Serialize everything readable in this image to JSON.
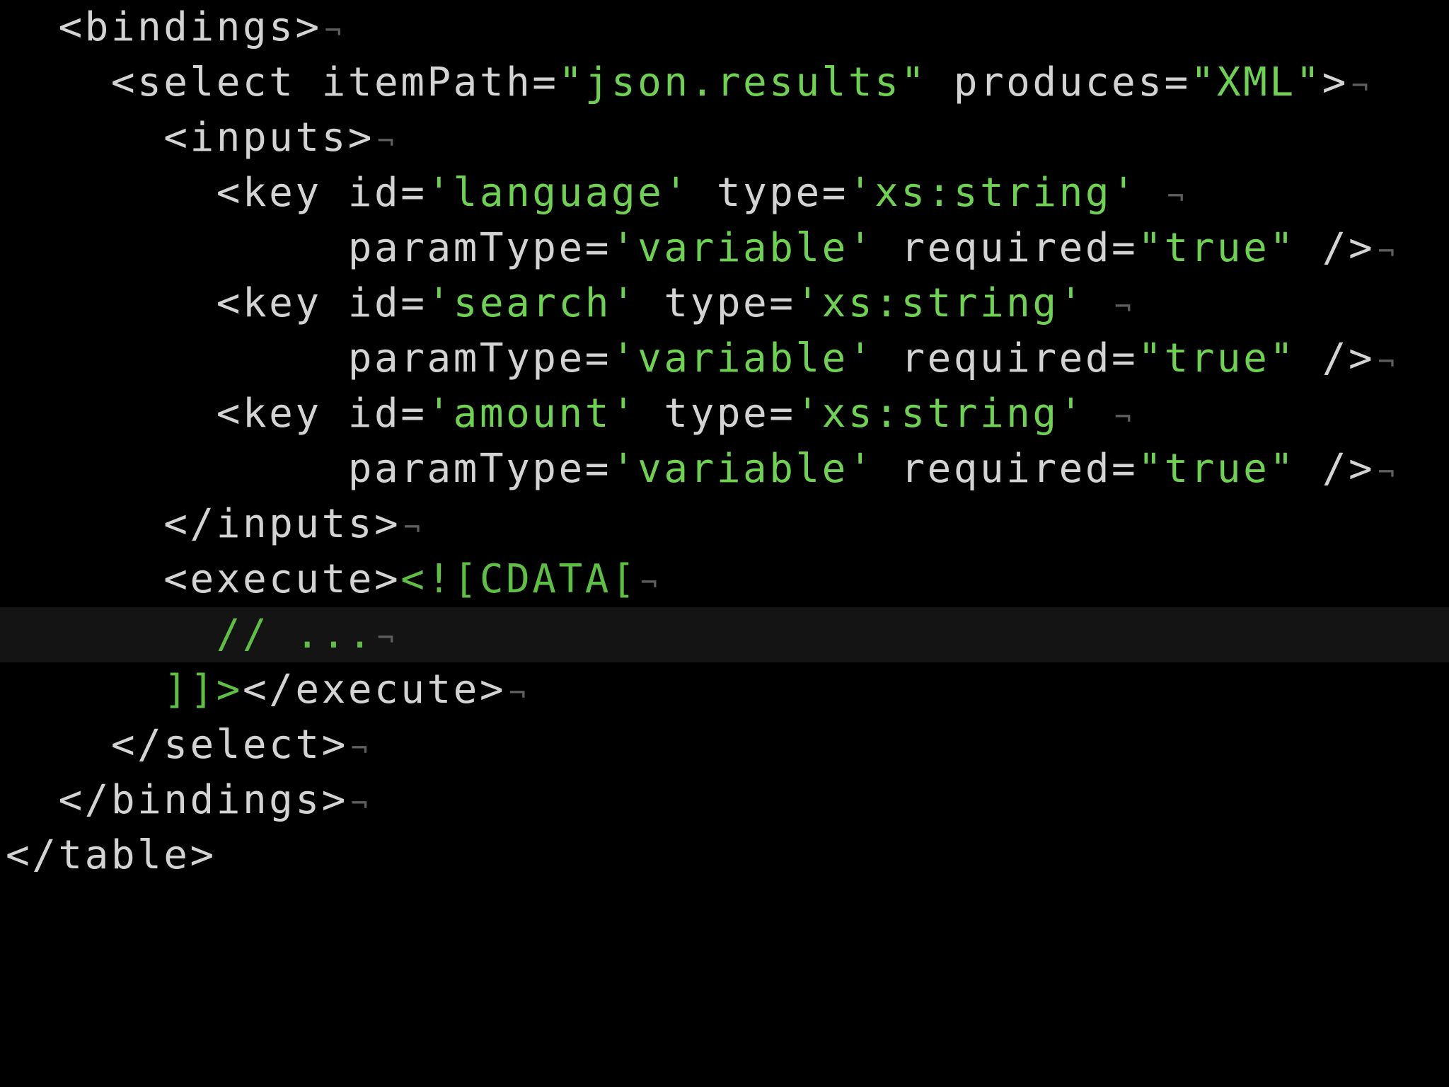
{
  "editor": {
    "theme_colors": {
      "background": "#000000",
      "current_line": "#141414",
      "text": "#d3d3d3",
      "string": "#6fd152",
      "cdata": "#5fbf45",
      "invisible": "#5e5e5e"
    },
    "end_of_line_marker": "¬",
    "current_line_index": 11,
    "lines": [
      {
        "indent": "  ",
        "tokens": [
          {
            "text": "<bindings>",
            "kind": "t"
          }
        ],
        "eol": true
      },
      {
        "indent": "    ",
        "tokens": [
          {
            "text": "<select itemPath=",
            "kind": "t"
          },
          {
            "text": "\"json.results\"",
            "kind": "s"
          },
          {
            "text": " produces=",
            "kind": "t"
          },
          {
            "text": "\"XML\"",
            "kind": "s"
          },
          {
            "text": ">",
            "kind": "t"
          }
        ],
        "eol": true
      },
      {
        "indent": "      ",
        "tokens": [
          {
            "text": "<inputs>",
            "kind": "t"
          }
        ],
        "eol": true
      },
      {
        "indent": "        ",
        "tokens": [
          {
            "text": "<key id=",
            "kind": "t"
          },
          {
            "text": "'language'",
            "kind": "s"
          },
          {
            "text": " type=",
            "kind": "t"
          },
          {
            "text": "'xs:string'",
            "kind": "s"
          },
          {
            "text": " ",
            "kind": "t"
          }
        ],
        "eol": true
      },
      {
        "indent": "             ",
        "tokens": [
          {
            "text": "paramType=",
            "kind": "t"
          },
          {
            "text": "'variable'",
            "kind": "s"
          },
          {
            "text": " required=",
            "kind": "t"
          },
          {
            "text": "\"true\"",
            "kind": "s"
          },
          {
            "text": " />",
            "kind": "t"
          }
        ],
        "eol": true
      },
      {
        "indent": "        ",
        "tokens": [
          {
            "text": "<key id=",
            "kind": "t"
          },
          {
            "text": "'search'",
            "kind": "s"
          },
          {
            "text": " type=",
            "kind": "t"
          },
          {
            "text": "'xs:string'",
            "kind": "s"
          },
          {
            "text": " ",
            "kind": "t"
          }
        ],
        "eol": true
      },
      {
        "indent": "             ",
        "tokens": [
          {
            "text": "paramType=",
            "kind": "t"
          },
          {
            "text": "'variable'",
            "kind": "s"
          },
          {
            "text": " required=",
            "kind": "t"
          },
          {
            "text": "\"true\"",
            "kind": "s"
          },
          {
            "text": " />",
            "kind": "t"
          }
        ],
        "eol": true
      },
      {
        "indent": "        ",
        "tokens": [
          {
            "text": "<key id=",
            "kind": "t"
          },
          {
            "text": "'amount'",
            "kind": "s"
          },
          {
            "text": " type=",
            "kind": "t"
          },
          {
            "text": "'xs:string'",
            "kind": "s"
          },
          {
            "text": " ",
            "kind": "t"
          }
        ],
        "eol": true
      },
      {
        "indent": "             ",
        "tokens": [
          {
            "text": "paramType=",
            "kind": "t"
          },
          {
            "text": "'variable'",
            "kind": "s"
          },
          {
            "text": " required=",
            "kind": "t"
          },
          {
            "text": "\"true\"",
            "kind": "s"
          },
          {
            "text": " />",
            "kind": "t"
          }
        ],
        "eol": true
      },
      {
        "indent": "      ",
        "tokens": [
          {
            "text": "</inputs>",
            "kind": "t"
          }
        ],
        "eol": true
      },
      {
        "indent": "      ",
        "tokens": [
          {
            "text": "<execute>",
            "kind": "t"
          },
          {
            "text": "<![CDATA[",
            "kind": "c"
          }
        ],
        "eol": true
      },
      {
        "indent": "        ",
        "tokens": [
          {
            "text": "// ...",
            "kind": "c"
          }
        ],
        "eol": true
      },
      {
        "indent": "      ",
        "tokens": [
          {
            "text": "]]>",
            "kind": "c"
          },
          {
            "text": "</execute>",
            "kind": "t"
          }
        ],
        "eol": true
      },
      {
        "indent": "    ",
        "tokens": [
          {
            "text": "</select>",
            "kind": "t"
          }
        ],
        "eol": true
      },
      {
        "indent": "  ",
        "tokens": [
          {
            "text": "</bindings>",
            "kind": "t"
          }
        ],
        "eol": true
      },
      {
        "indent": "",
        "tokens": [
          {
            "text": "</table>",
            "kind": "t"
          }
        ],
        "eol": false
      }
    ]
  }
}
